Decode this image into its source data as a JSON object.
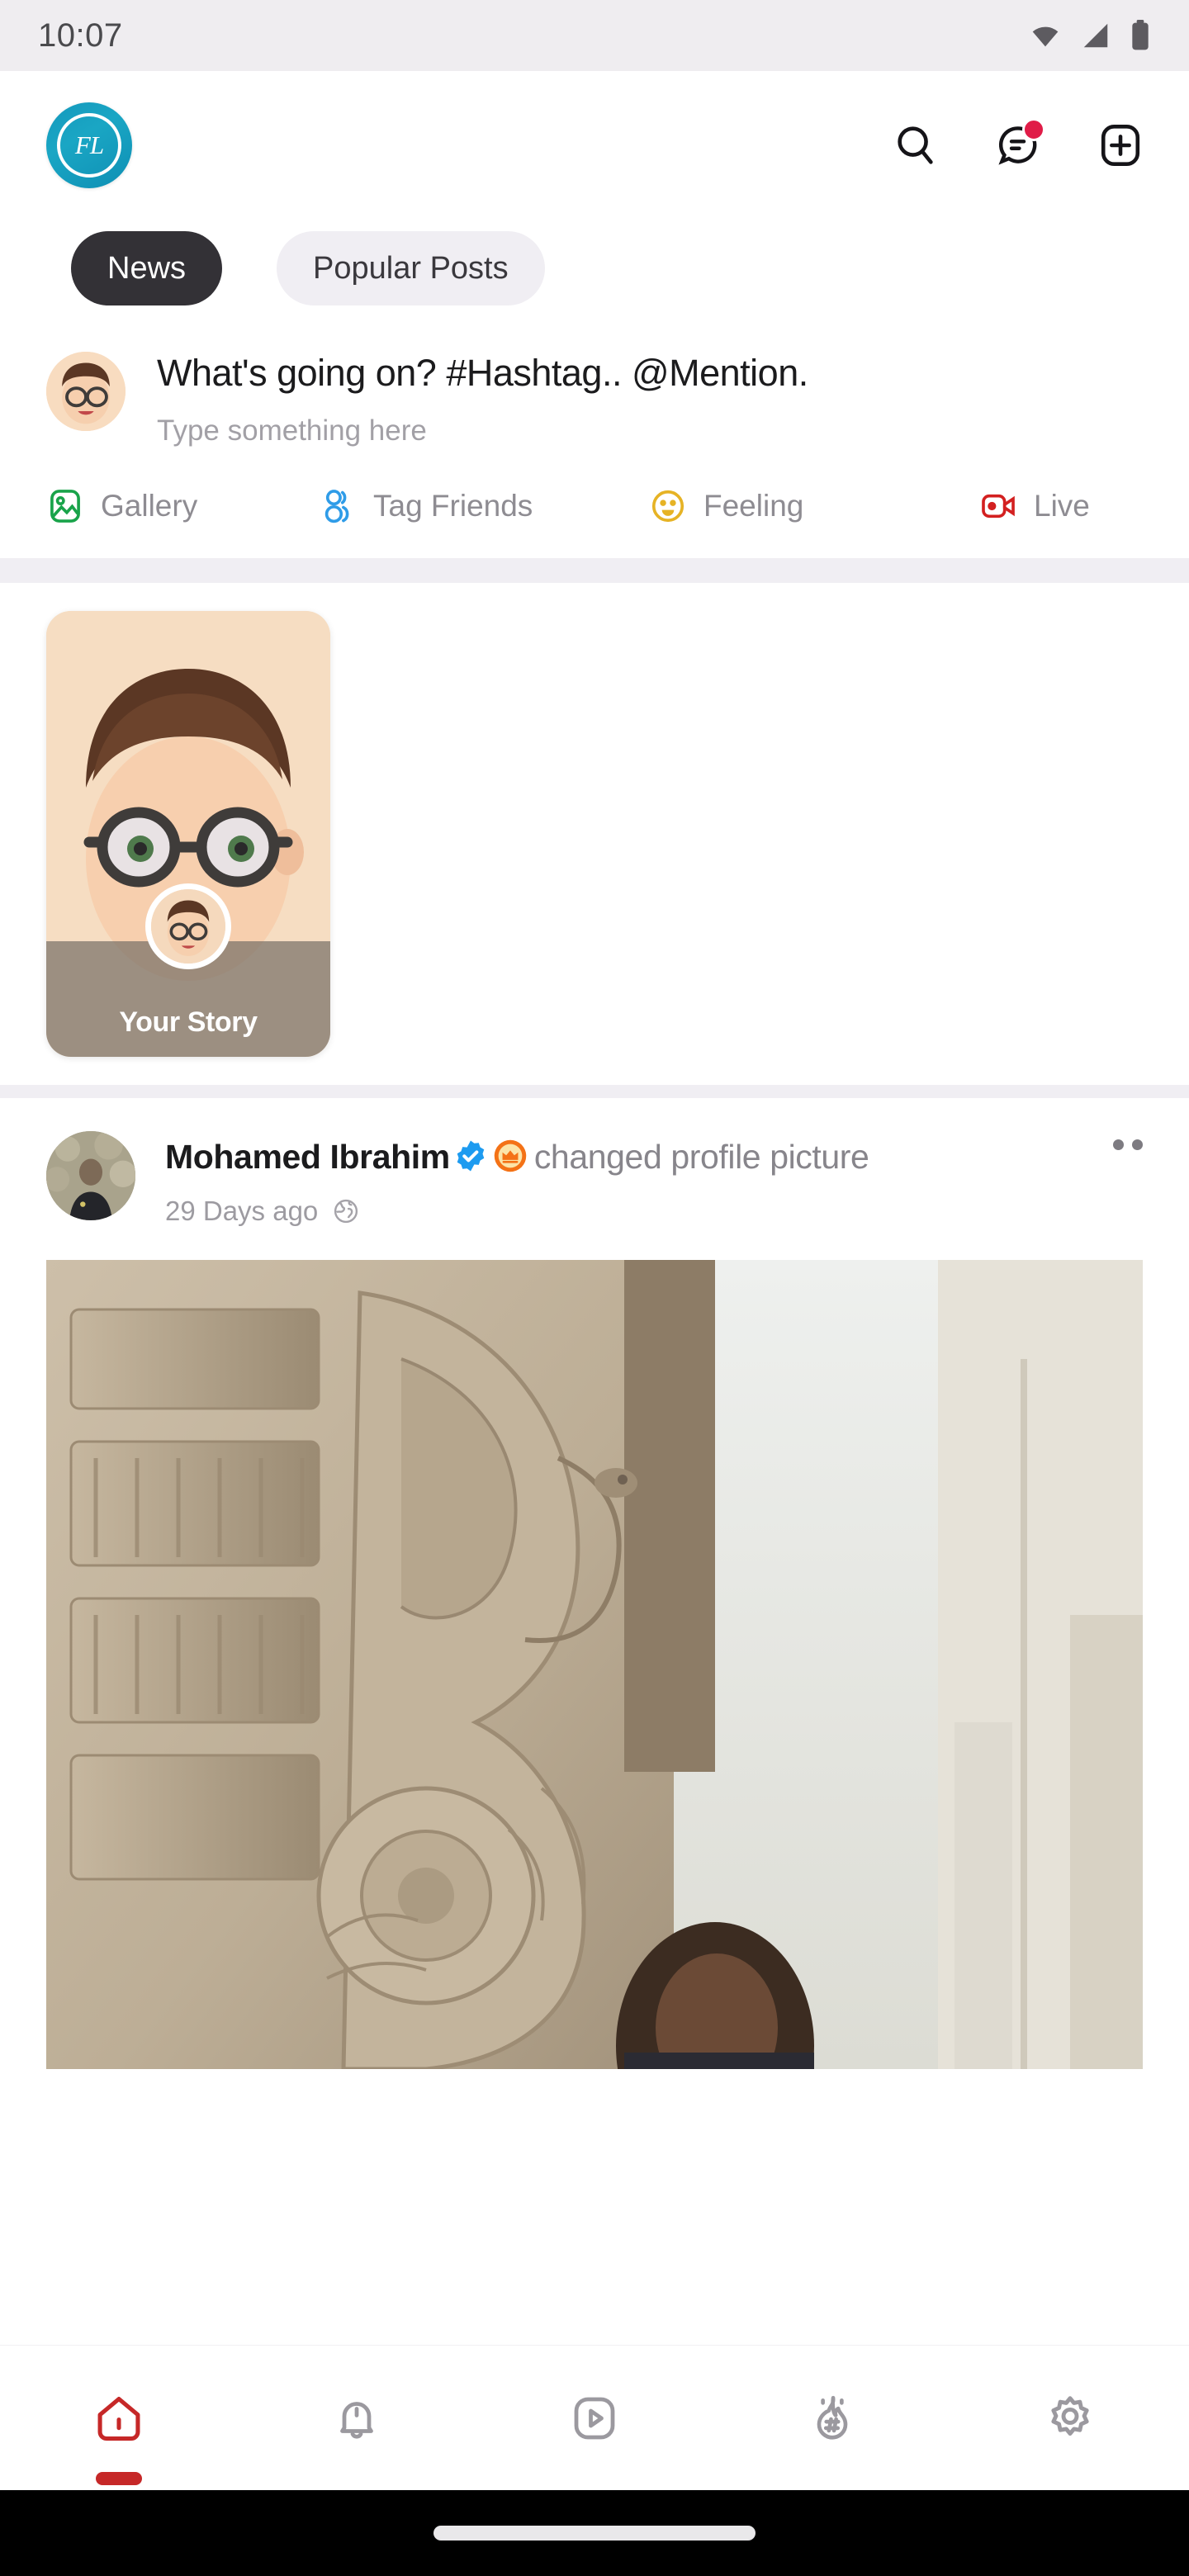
{
  "status_bar": {
    "time": "10:07",
    "icons": [
      "wifi-icon",
      "cellular-signal-icon",
      "battery-icon"
    ]
  },
  "app_bar": {
    "logo_text": "FL",
    "logo_name": "app-logo",
    "brand_color": "#1499bd",
    "actions": [
      {
        "name": "search-icon",
        "label": "Search"
      },
      {
        "name": "messages-icon",
        "label": "Messages",
        "has_badge": true,
        "badge_color": "#e01c47"
      },
      {
        "name": "add-post-icon",
        "label": "Create"
      }
    ]
  },
  "tabs": [
    {
      "label": "News",
      "active": true
    },
    {
      "label": "Popular Posts",
      "active": false
    }
  ],
  "composer": {
    "title": "What's going on? #Hashtag.. @Mention.",
    "placeholder": "Type something here",
    "avatar_name": "composer-user-avatar",
    "actions": [
      {
        "label": "Gallery",
        "icon": "gallery-icon",
        "color": "#19a34a"
      },
      {
        "label": "Tag Friends",
        "icon": "tag-friends-icon",
        "color": "#2f9ce8"
      },
      {
        "label": "Feeling",
        "icon": "feeling-icon",
        "color": "#e6b325"
      },
      {
        "label": "Live",
        "icon": "live-icon",
        "color": "#d32020"
      }
    ]
  },
  "stories": [
    {
      "label": "Your Story",
      "is_own": true
    }
  ],
  "post": {
    "author": "Mohamed Ibrahim",
    "verified": true,
    "crown": true,
    "action_text": "changed profile picture",
    "timestamp": "29 Days ago",
    "privacy_icon": "globe-icon",
    "menu_icon": "more-options-icon",
    "image_name": "post-photo-stone-carving"
  },
  "bottom_nav": [
    {
      "label": "Home",
      "icon": "home-icon",
      "active": true,
      "color": "#c62828"
    },
    {
      "label": "Notifications",
      "icon": "bell-icon",
      "active": false,
      "color": "#9b999f"
    },
    {
      "label": "Videos",
      "icon": "video-play-icon",
      "active": false,
      "color": "#9b999f"
    },
    {
      "label": "Trending",
      "icon": "flame-hashtag-icon",
      "active": false,
      "color": "#9b999f"
    },
    {
      "label": "Settings",
      "icon": "gear-icon",
      "active": false,
      "color": "#9b999f"
    }
  ]
}
